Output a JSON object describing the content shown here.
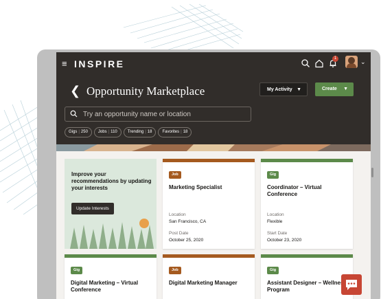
{
  "header": {
    "brand": "INSPIRE",
    "notification_count": "1",
    "page_title": "Opportunity Marketplace",
    "my_activity_label": "My Activity",
    "create_label": "Create",
    "search_placeholder": "Try an opportunity name or location"
  },
  "filters": [
    {
      "label": "Gigs",
      "count": "250"
    },
    {
      "label": "Jobs",
      "count": "110"
    },
    {
      "label": "Trending",
      "count": "18"
    },
    {
      "label": "Favorites",
      "count": "18"
    }
  ],
  "interests_card": {
    "text": "Improve your recommendations by updating your interests",
    "button_label": "Update Interests"
  },
  "cards": [
    {
      "type": "Job",
      "title": "Marketing Specialist",
      "label1": "Location",
      "value1": "San Francisco, CA",
      "label2": "Post Date",
      "value2": "October 25, 2020"
    },
    {
      "type": "Gig",
      "title": "Coordinator – Virtual Conference",
      "label1": "Location",
      "value1": "Flexible",
      "label2": "Start Date",
      "value2": "October 23, 2020"
    },
    {
      "type": "Gig",
      "title": "Digital Marketing – Virtual Conference"
    },
    {
      "type": "Job",
      "title": "Digital Marketing Manager"
    },
    {
      "type": "Gig",
      "title": "Assistant Designer – Wellness Program"
    }
  ],
  "colors": {
    "header_bg": "#312d2a",
    "gig_accent": "#5c8a4a",
    "job_accent": "#a55a1f",
    "notification": "#c74634"
  }
}
